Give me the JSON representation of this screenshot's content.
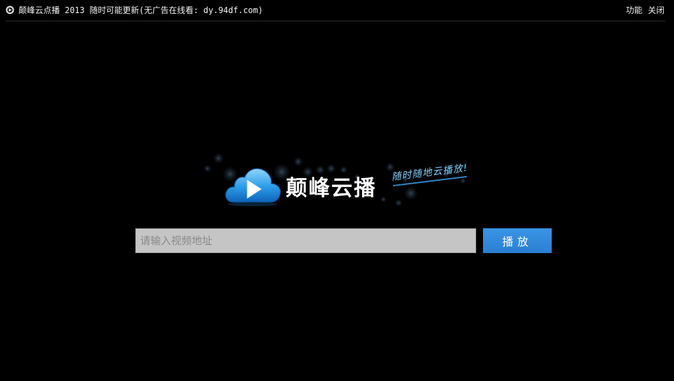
{
  "window": {
    "title": "颠峰云点播 2013 随时可能更新(无广告在线看: dy.94df.com)",
    "menu_features": "功能",
    "menu_close": "关闭"
  },
  "brand": {
    "name": "颠峰云播",
    "slogan": "随时随地云播放!"
  },
  "search": {
    "placeholder": "请输入视频地址",
    "value": "",
    "play_label": "播放"
  },
  "colors": {
    "background": "#000000",
    "accent": "#2f86d6",
    "input_bg": "#c5c5c5"
  },
  "icons": {
    "app_icon": "app-logo-icon",
    "logo": "cloud-play-icon"
  }
}
